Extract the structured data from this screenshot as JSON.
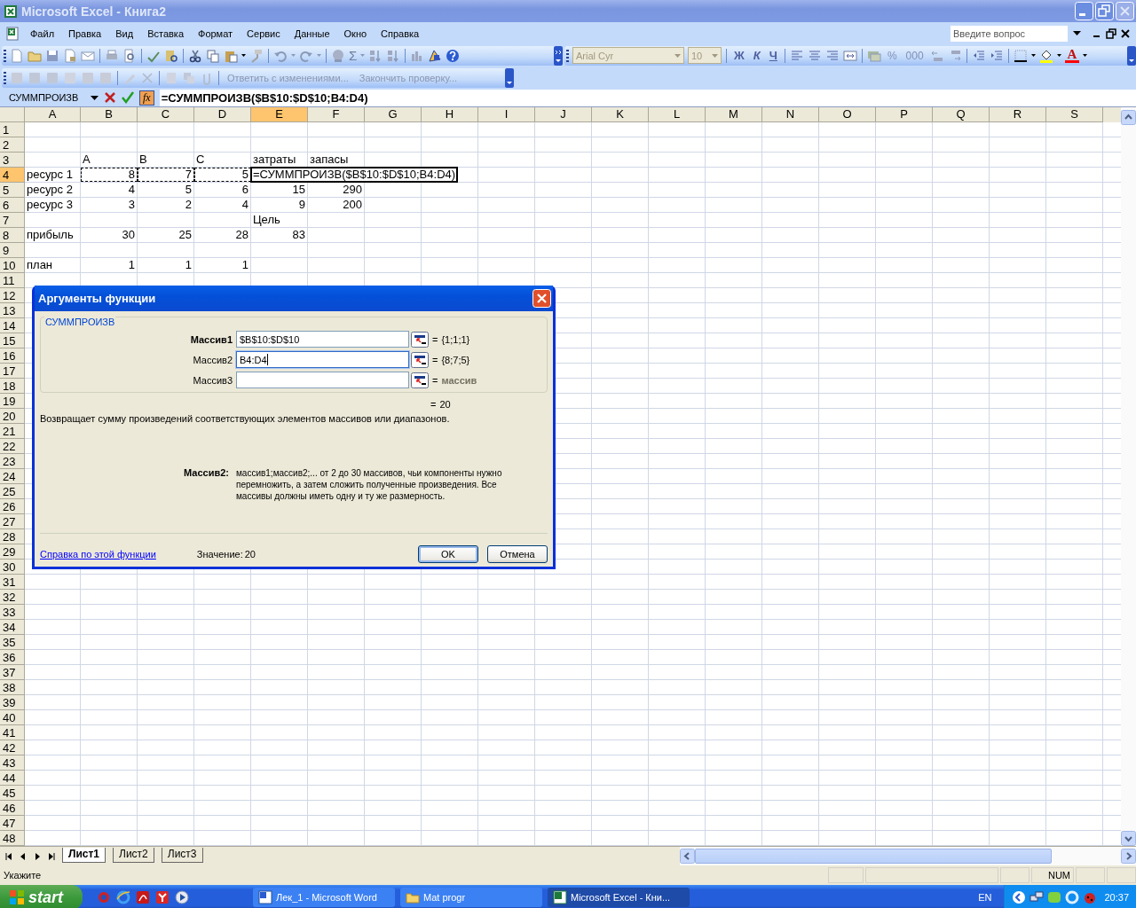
{
  "window": {
    "title": "Microsoft Excel - Книга2"
  },
  "menu": [
    "Файл",
    "Правка",
    "Вид",
    "Вставка",
    "Формат",
    "Сервис",
    "Данные",
    "Окно",
    "Справка"
  ],
  "help_search": {
    "placeholder": "Введите вопрос"
  },
  "standard_toolbar": {
    "autosum": "Σ"
  },
  "formatting_toolbar": {
    "font": "Arial Cyr",
    "size": "10",
    "bold": "Ж",
    "italic": "К",
    "underline": "Ч",
    "percent": "%",
    "thousands": "000",
    "font_color": "A"
  },
  "reviewing_toolbar": {
    "reply": "Ответить с изменениями...",
    "end_review": "Закончить проверку..."
  },
  "formula_bar": {
    "name_box": "СУММПРОИЗВ",
    "insert_function": "fx",
    "formula": "=СУММПРОИЗВ($B$10:$D$10;B4:D4)"
  },
  "sheet": {
    "columns": [
      {
        "label": "A",
        "selected": false
      },
      {
        "label": "B",
        "selected": false
      },
      {
        "label": "C",
        "selected": false
      },
      {
        "label": "D",
        "selected": false
      },
      {
        "label": "E",
        "selected": true
      },
      {
        "label": "F",
        "selected": false
      },
      {
        "label": "G",
        "selected": false
      },
      {
        "label": "H",
        "selected": false
      },
      {
        "label": "I",
        "selected": false
      },
      {
        "label": "J",
        "selected": false
      },
      {
        "label": "K",
        "selected": false
      },
      {
        "label": "L",
        "selected": false
      },
      {
        "label": "M",
        "selected": false
      },
      {
        "label": "N",
        "selected": false
      },
      {
        "label": "O",
        "selected": false
      },
      {
        "label": "P",
        "selected": false
      },
      {
        "label": "Q",
        "selected": false
      },
      {
        "label": "R",
        "selected": false
      },
      {
        "label": "S",
        "selected": false
      }
    ],
    "rows": [
      {
        "label": "1",
        "selected": false
      },
      {
        "label": "2",
        "selected": false
      },
      {
        "label": "3",
        "selected": false,
        "cells": [
          {},
          {
            "text": "A",
            "kind": "text"
          },
          {
            "text": "B",
            "kind": "text"
          },
          {
            "text": "C",
            "kind": "text"
          },
          {
            "text": "затраты",
            "kind": "text"
          },
          {
            "text": "запасы",
            "kind": "text"
          }
        ]
      },
      {
        "label": "4",
        "selected": true,
        "cells": [
          {
            "text": "ресурс 1",
            "kind": "text"
          },
          {
            "text": "8",
            "kind": "number",
            "marquee": true
          },
          {
            "text": "7",
            "kind": "number",
            "marquee": true
          },
          {
            "text": "5",
            "kind": "number",
            "marquee": true
          },
          {
            "text": "=СУММПРОИЗВ($B$10:$D$10;B4:D4)",
            "kind": "editing"
          }
        ]
      },
      {
        "label": "5",
        "selected": false,
        "cells": [
          {
            "text": "ресурс 2",
            "kind": "text"
          },
          {
            "text": "4",
            "kind": "number"
          },
          {
            "text": "5",
            "kind": "number"
          },
          {
            "text": "6",
            "kind": "number"
          },
          {
            "text": "15",
            "kind": "number"
          },
          {
            "text": "290",
            "kind": "number"
          }
        ]
      },
      {
        "label": "6",
        "selected": false,
        "cells": [
          {
            "text": "ресурс 3",
            "kind": "text"
          },
          {
            "text": "3",
            "kind": "number"
          },
          {
            "text": "2",
            "kind": "number"
          },
          {
            "text": "4",
            "kind": "number"
          },
          {
            "text": "9",
            "kind": "number"
          },
          {
            "text": "200",
            "kind": "number"
          }
        ]
      },
      {
        "label": "7",
        "selected": false,
        "cells": [
          {},
          {},
          {},
          {},
          {
            "text": "Цель",
            "kind": "text"
          }
        ]
      },
      {
        "label": "8",
        "selected": false,
        "cells": [
          {
            "text": "прибыль",
            "kind": "text"
          },
          {
            "text": "30",
            "kind": "number"
          },
          {
            "text": "25",
            "kind": "number"
          },
          {
            "text": "28",
            "kind": "number"
          },
          {
            "text": "83",
            "kind": "number"
          }
        ]
      },
      {
        "label": "9",
        "selected": false
      },
      {
        "label": "10",
        "selected": false,
        "cells": [
          {
            "text": "план",
            "kind": "text"
          },
          {
            "text": "1",
            "kind": "number"
          },
          {
            "text": "1",
            "kind": "number"
          },
          {
            "text": "1",
            "kind": "number"
          }
        ]
      },
      {
        "label": "11",
        "selected": false
      },
      {
        "label": "12",
        "selected": false
      },
      {
        "label": "13",
        "selected": false
      },
      {
        "label": "14",
        "selected": false
      },
      {
        "label": "15",
        "selected": false
      },
      {
        "label": "16",
        "selected": false
      },
      {
        "label": "17",
        "selected": false
      },
      {
        "label": "18",
        "selected": false
      },
      {
        "label": "19",
        "selected": false
      },
      {
        "label": "20",
        "selected": false
      },
      {
        "label": "21",
        "selected": false
      },
      {
        "label": "22",
        "selected": false
      },
      {
        "label": "23",
        "selected": false
      },
      {
        "label": "24",
        "selected": false
      },
      {
        "label": "25",
        "selected": false
      },
      {
        "label": "26",
        "selected": false
      },
      {
        "label": "27",
        "selected": false
      },
      {
        "label": "28",
        "selected": false
      },
      {
        "label": "29",
        "selected": false
      },
      {
        "label": "30",
        "selected": false
      },
      {
        "label": "31",
        "selected": false
      },
      {
        "label": "32",
        "selected": false
      },
      {
        "label": "33",
        "selected": false
      },
      {
        "label": "34",
        "selected": false
      },
      {
        "label": "35",
        "selected": false
      },
      {
        "label": "36",
        "selected": false
      },
      {
        "label": "37",
        "selected": false
      },
      {
        "label": "38",
        "selected": false
      },
      {
        "label": "39",
        "selected": false
      },
      {
        "label": "40",
        "selected": false
      },
      {
        "label": "41",
        "selected": false
      },
      {
        "label": "42",
        "selected": false
      },
      {
        "label": "43",
        "selected": false
      },
      {
        "label": "44",
        "selected": false
      },
      {
        "label": "45",
        "selected": false
      },
      {
        "label": "46",
        "selected": false
      },
      {
        "label": "47",
        "selected": false
      },
      {
        "label": "48",
        "selected": false
      }
    ]
  },
  "sheet_tabs": [
    {
      "label": "Лист1",
      "selected": true
    },
    {
      "label": "Лист2",
      "selected": false
    },
    {
      "label": "Лист3",
      "selected": false
    }
  ],
  "status_bar": {
    "message": "Укажите",
    "num_lock": "NUM"
  },
  "dialog": {
    "title": "Аргументы функции",
    "function": "СУММПРОИЗВ",
    "arguments": [
      {
        "label": "Массив1",
        "required": true,
        "value": "$B$10:$D$10",
        "focused": false,
        "equals": "=",
        "result": "{1;1;1}",
        "hint": false
      },
      {
        "label": "Массив2",
        "required": false,
        "value": "B4:D4",
        "focused": true,
        "equals": "=",
        "result": "{8;7;5}",
        "hint": false
      },
      {
        "label": "Массив3",
        "required": false,
        "focused": false,
        "equals": "=",
        "result": "массив",
        "hint": true
      }
    ],
    "result_equals": "=",
    "result": "20",
    "description": "Возвращает сумму произведений соответствующих элементов массивов или диапазонов.",
    "argument_help": {
      "label": "Массив2:",
      "text": "массив1;массив2;... от 2 до 30 массивов, чьи компоненты нужно перемножить, а затем сложить полученные произведения. Все массивы должны иметь одну и ту же размерность."
    },
    "help_link": "Справка по этой функции",
    "value_label": "Значение:",
    "value": "20",
    "buttons": [
      {
        "label": "OK",
        "default": true
      },
      {
        "label": "Отмена",
        "default": false
      }
    ]
  },
  "taskbar": {
    "start": "start",
    "tasks": [
      {
        "label": "Лек_1 - Microsoft Word",
        "kind": "word",
        "selected": false
      },
      {
        "label": "Mat progr",
        "kind": "folder",
        "selected": false
      },
      {
        "label": "Microsoft Excel - Кни...",
        "kind": "excel",
        "selected": true
      }
    ],
    "language": "EN",
    "clock": "20:37"
  }
}
